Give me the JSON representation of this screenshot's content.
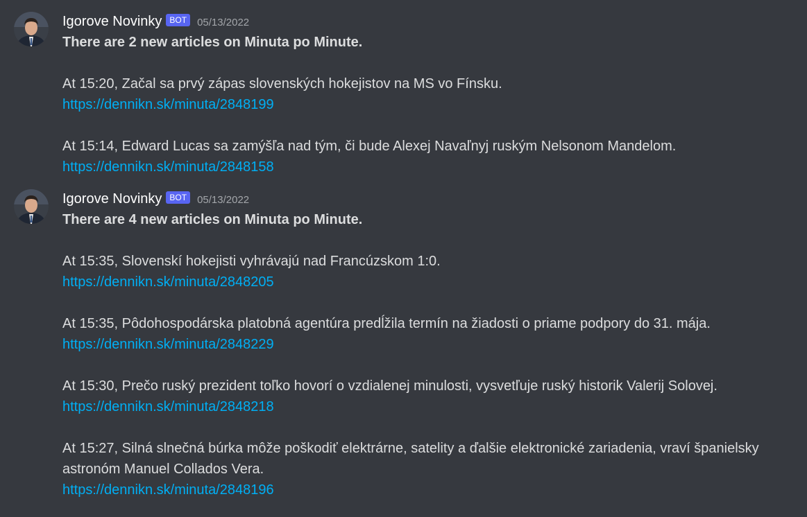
{
  "messages": [
    {
      "username": "Igorove Novinky",
      "badge": "BOT",
      "timestamp": "05/13/2022",
      "headline": "There are 2 new articles on Minuta po Minute.",
      "articles": [
        {
          "text": "At 15:20, Začal sa prvý zápas slovenských hokejistov na MS vo Fínsku.",
          "link": "https://dennikn.sk/minuta/2848199"
        },
        {
          "text": "At 15:14, Edward Lucas sa zamýšľa nad tým, či bude Alexej Navaľnyj ruským Nelsonom Mandelom.",
          "link": "https://dennikn.sk/minuta/2848158"
        }
      ]
    },
    {
      "username": "Igorove Novinky",
      "badge": "BOT",
      "timestamp": "05/13/2022",
      "headline": "There are 4 new articles on Minuta po Minute.",
      "articles": [
        {
          "text": "At 15:35, Slovenskí hokejisti vyhrávajú nad Francúzskom 1:0.",
          "link": "https://dennikn.sk/minuta/2848205"
        },
        {
          "text": "At 15:35, Pôdohospodárska platobná agentúra predĺžila termín na žiadosti o priame podpory do 31. mája.",
          "link": "https://dennikn.sk/minuta/2848229"
        },
        {
          "text": "At 15:30, Prečo ruský prezident toľko hovorí o vzdialenej minulosti, vysvetľuje ruský historik Valerij Solovej.",
          "link": "https://dennikn.sk/minuta/2848218"
        },
        {
          "text_line1": "At 15:27, Silná slnečná búrka môže poškodiť elektrárne, satelity a ďalšie elektronické zariadenia, vraví španielsky",
          "text_line2": "astronóm Manuel Collados Vera.",
          "link": "https://dennikn.sk/minuta/2848196"
        }
      ]
    }
  ],
  "colors": {
    "background": "#36393f",
    "text": "#dcddde",
    "username": "#ffffff",
    "timestamp": "#a3a6aa",
    "link": "#00aff4",
    "bot_badge": "#5865f2"
  }
}
